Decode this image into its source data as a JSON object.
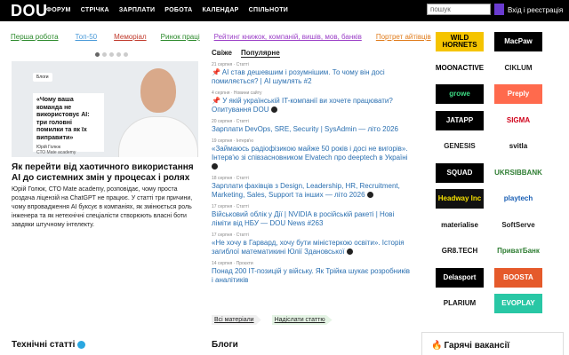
{
  "header": {
    "logo": "DOU",
    "nav": [
      "ФОРУМ",
      "СТРІЧКА",
      "ЗАРПЛАТИ",
      "РОБОТА",
      "КАЛЕНДАР",
      "СПІЛЬНОТИ"
    ],
    "search_placeholder": "пошук",
    "login": "Вхід і реєстрація"
  },
  "subnav": [
    "Перша робота",
    "Топ-50",
    "Меморіал",
    "Ринок праці",
    "Рейтинг книжок, компаній, вишів, мов, банків",
    "Портрет айтівців"
  ],
  "carousel": {
    "dots": 5,
    "active": 0
  },
  "hero": {
    "badge": "Блоги",
    "quote": "«Чому ваша команда не використовує AI: три головні помилки та як їх виправити»",
    "author": "Юрій Голюк",
    "role": "СТО Mate academy",
    "title": "Як перейти від хаотичного використання AI до системних змін у процесах і ролях",
    "text": "Юрій Голюк, СТО Mate academy, розповідає, чому проста роздача ліцензій на ChatGPT не працює. У статті три причини, чому впровадження AI буксує в компаніях, як змінюється роль інженера та як нетехнічні спеціалісти створюють власні боти завдяки штучному інтелекту."
  },
  "feed": {
    "tabs": [
      "Свіже",
      "Популярне"
    ],
    "active_tab": 1,
    "items": [
      {
        "meta": "21 серпня · Статті",
        "title": "AI став дешевшим і розумнішим. То чому він досі помиляється? | AI шумлять #2",
        "pinned": true,
        "comments": false
      },
      {
        "meta": "4 серпня · Новини сайту",
        "title": "У якій українській IT-компанії ви хочете працювати? Опитування DOU",
        "pinned": true,
        "comments": true
      },
      {
        "meta": "20 серпня · Статті",
        "title": "Зарплати DevOps, SRE, Security | SysAdmin — літо 2026",
        "pinned": false,
        "comments": false
      },
      {
        "meta": "19 серпня · Інтерв'ю",
        "title": "«Займаюсь радіофізикою майже 50 років і досі не вигорів». Інтерв'ю зі співзасновником Elvatech про deeptech в Україні",
        "pinned": false,
        "comments": true
      },
      {
        "meta": "18 серпня · Статті",
        "title": "Зарплати фахівців з Design, Leadership, HR, Recruitment, Marketing, Sales, Support та інших — літо 2026",
        "pinned": false,
        "comments": true
      },
      {
        "meta": "17 серпня · Статті",
        "title": "Військовий облік у Дії | NVIDIA в російській ракеті | Нові ліміти від НБУ — DOU News #263",
        "pinned": false,
        "comments": false
      },
      {
        "meta": "17 серпня · Статті",
        "title": "«Не хочу в Гарвард, хочу бути міністеркою освіти». Історія загиблої математикині Юлії Здановської",
        "pinned": false,
        "comments": true
      },
      {
        "meta": "14 серпня · Проєкти",
        "title": "Понад 200 IT-позицій у війську. Як Трійка шукає розробників і аналітиків",
        "pinned": false,
        "comments": false
      }
    ],
    "btn_all": "Всі матеріали",
    "btn_submit": "Надіслати статтю"
  },
  "sections": {
    "tech": "Технічні статті",
    "blogs": "Блоги",
    "hot": "Гарячі вакансії"
  },
  "logos": [
    {
      "name": "WILD HORNETS",
      "bg": "#f5c400",
      "fg": "#000"
    },
    {
      "name": "MacPaw",
      "bg": "#000",
      "fg": "#fff"
    },
    {
      "name": "MOONACTIVE",
      "bg": "#fff",
      "fg": "#000"
    },
    {
      "name": "CIKLUM",
      "bg": "#fff",
      "fg": "#222"
    },
    {
      "name": "growe",
      "bg": "#000",
      "fg": "#3ddc84"
    },
    {
      "name": "Preply",
      "bg": "#ff6a4d",
      "fg": "#fff"
    },
    {
      "name": "JATAPP",
      "bg": "#000",
      "fg": "#fff"
    },
    {
      "name": "SIGMA",
      "bg": "#fff",
      "fg": "#d0021b"
    },
    {
      "name": "GENESIS",
      "bg": "#fff",
      "fg": "#222"
    },
    {
      "name": "svitla",
      "bg": "#fff",
      "fg": "#111"
    },
    {
      "name": "SQUAD",
      "bg": "#000",
      "fg": "#fff"
    },
    {
      "name": "UKRSIBBANK",
      "bg": "#fff",
      "fg": "#2e7d32"
    },
    {
      "name": "Headway Inc",
      "bg": "#111",
      "fg": "#f5e000"
    },
    {
      "name": "playtech",
      "bg": "#fff",
      "fg": "#1a5fb4"
    },
    {
      "name": "materialise",
      "bg": "#fff",
      "fg": "#111"
    },
    {
      "name": "SoftServe",
      "bg": "#fff",
      "fg": "#222"
    },
    {
      "name": "GR8.TECH",
      "bg": "#fff",
      "fg": "#111"
    },
    {
      "name": "ПриватБанк",
      "bg": "#fff",
      "fg": "#2e7d32"
    },
    {
      "name": "Delasport",
      "bg": "#000",
      "fg": "#fff"
    },
    {
      "name": "BOOSTA",
      "bg": "#e55a2b",
      "fg": "#fff"
    },
    {
      "name": "PLARIUM",
      "bg": "#fff",
      "fg": "#111"
    },
    {
      "name": "EVOPLAY",
      "bg": "#29c7a5",
      "fg": "#fff"
    }
  ]
}
